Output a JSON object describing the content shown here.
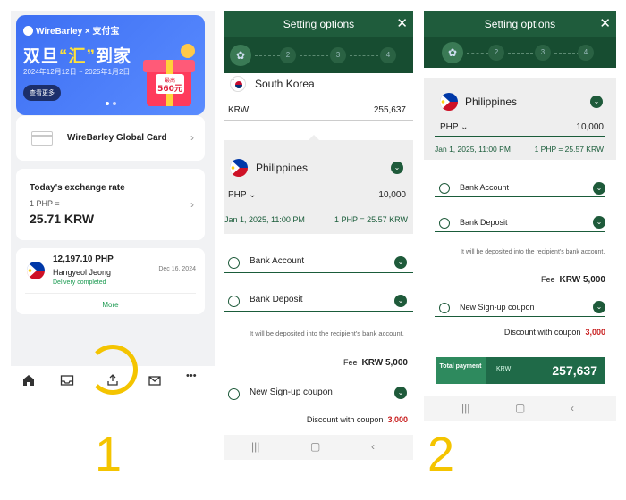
{
  "panel1": {
    "banner": {
      "brand": "WireBarley × 支付宝",
      "headline_pre": "双旦",
      "headline_hl": "“汇”",
      "headline_post": "到家",
      "dates": "2024年12月12日 ~ 2025年1月2日",
      "view_more": "查看更多",
      "coupon_top": "最高",
      "coupon_amt": "560元"
    },
    "global_card": {
      "label": "WireBarley Global Card"
    },
    "rate": {
      "title": "Today's exchange rate",
      "sub": "1 PHP =",
      "value": "25.71 KRW"
    },
    "transaction": {
      "amount": "12,197.10 PHP",
      "name": "Hangyeol Jeong",
      "status": "Delivery completed",
      "date": "Dec 16, 2024",
      "more": "More"
    },
    "tabs": [
      "home-icon",
      "inbox-icon",
      "send-icon",
      "mail-icon",
      "more-icon"
    ],
    "more_dots": "•••",
    "step_digit": "1"
  },
  "panel2": {
    "title": "Setting options",
    "steps": [
      "2",
      "3",
      "4"
    ],
    "from_country": "South Korea",
    "from_currency": "KRW",
    "from_amount": "255,637",
    "to_country": "Philippines",
    "to_currency": "PHP",
    "to_amount": "10,000",
    "rate_date": "Jan 1, 2025, 11:00 PM",
    "rate_value": "1 PHP = 25.57 KRW",
    "option1": "Bank Account",
    "option2": "Bank Deposit",
    "note": "It will be deposited into the recipient's bank account.",
    "fee_label": "Fee",
    "fee_value": "KRW 5,000",
    "coupon": "New Sign-up coupon",
    "discount_label": "Discount with coupon",
    "discount_value": "3,000"
  },
  "panel3": {
    "title": "Setting options",
    "steps": [
      "2",
      "3",
      "4"
    ],
    "to_country": "Philippines",
    "to_currency": "PHP",
    "to_amount": "10,000",
    "rate_date": "Jan 1, 2025, 11:00 PM",
    "rate_value": "1 PHP = 25.57 KRW",
    "option1": "Bank Account",
    "option2": "Bank Deposit",
    "note": "It will be deposited into the recipient's bank account.",
    "fee_label": "Fee",
    "fee_value": "KRW 5,000",
    "coupon": "New Sign-up coupon",
    "discount_label": "Discount with coupon",
    "discount_value": "3,000",
    "total_label": "Total payment",
    "total_currency": "KRW",
    "total_value": "257,637",
    "step_digit": "2"
  },
  "colors": {
    "brand_green": "#1f5c3c",
    "accent_yellow": "#f4c400",
    "discount_red": "#c81e1e",
    "banner_blue": "#3d6ff3"
  }
}
